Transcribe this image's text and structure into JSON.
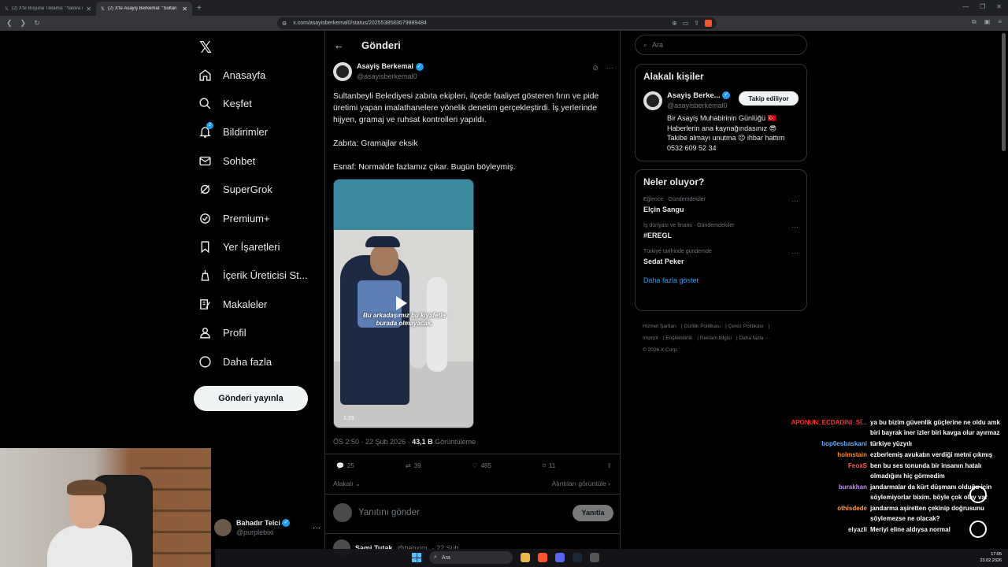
{
  "browser": {
    "tabs": [
      {
        "title": "(2) X'te Boşuna Tıklama: \"Yalova da h",
        "active": false
      },
      {
        "title": "(2) X'te Asayiş Berkemal: \"Sultan",
        "active": true
      }
    ],
    "url": "x.com/asayisberkemal0/status/2025538583679889484"
  },
  "nav": {
    "items": [
      {
        "label": "Anasayfa",
        "icon": "home-icon"
      },
      {
        "label": "Keşfet",
        "icon": "search-icon"
      },
      {
        "label": "Bildirimler",
        "icon": "bell-icon",
        "badge": "2"
      },
      {
        "label": "Sohbet",
        "icon": "mail-icon"
      },
      {
        "label": "SuperGrok",
        "icon": "grok-icon"
      },
      {
        "label": "Premium+",
        "icon": "premium-icon"
      },
      {
        "label": "Yer İşaretleri",
        "icon": "bookmark-icon"
      },
      {
        "label": "İçerik Üreticisi St...",
        "icon": "creator-studio-icon"
      },
      {
        "label": "Makaleler",
        "icon": "articles-icon"
      },
      {
        "label": "Profil",
        "icon": "profile-icon"
      },
      {
        "label": "Daha fazla",
        "icon": "more-icon"
      }
    ],
    "post_button": "Gönderi yayınla"
  },
  "account": {
    "name": "Bahadır Telci",
    "handle": "@purplebixi"
  },
  "main": {
    "title": "Gönderi",
    "post": {
      "author": "Asayiş Berkemal",
      "handle": "@asayisberkemal0",
      "paragraphs": [
        "Sultanbeyli Belediyesi zabıta ekipleri, ilçede faaliyet gösteren fırın ve pide üretimi yapan imalathanelere yönelik denetim gerçekleştirdi. İş yerlerinde hijyen, gramaj ve ruhsat kontrolleri yapıldı.",
        "Zabıta: Gramajlar eksik",
        "Esnaf: Normalde fazlamız çıkar. Bugün böyleymiş."
      ],
      "video": {
        "caption_line1": "Bu arkadaşımız bu kıyafetle",
        "caption_line2": "burada olmayacak.",
        "duration": "1:29"
      },
      "time": "ÖS 2:50",
      "date": "22 Şub 2026",
      "views": "43,1 B",
      "views_label": "Görüntüleme",
      "stats": {
        "replies": "25",
        "reposts": "39",
        "likes": "485",
        "bookmarks": "11"
      },
      "relevancy": "Alakalı",
      "quotes_link": "Alıntıları görüntüle"
    },
    "reply": {
      "placeholder": "Yanıtını gönder",
      "button": "Yanıtla"
    },
    "next_post": {
      "author": "Sami Tutak",
      "handle": "@benxim",
      "time": "· 22 Şub"
    }
  },
  "sidebar": {
    "search_placeholder": "Ara",
    "relevant": {
      "title": "Alakalı kişiler",
      "name": "Asayiş Berke...",
      "handle": "@asayisberkemal0",
      "follow": "Takip ediliyor",
      "bio1": "Bir Asayiş Muhabirinin Günlüğü 🇹🇷",
      "bio2": "Haberlerin ana kaynağındasınız 😎",
      "bio3": "Takibe almayı unutma 😉 ihbar hattım",
      "bio4": "0532 609 52 34"
    },
    "trends": {
      "title": "Neler oluyor?",
      "items": [
        {
          "context": "Eğlence · Gündemdekiler",
          "name": "Elçin Sangu"
        },
        {
          "context": "İş dünyası ve finans · Gündemdekiler",
          "name": "#EREGL"
        },
        {
          "context": "Türkiye tarihinde gündemde",
          "name": "Sedat Peker"
        }
      ],
      "show_more": "Daha fazla göster"
    },
    "footer": [
      "Hizmet Şartları",
      "Gizlilik Politikası",
      "Çerez Politikası",
      "Imprint",
      "Erişilebilirlik",
      "Reklam bilgisi",
      "Daha fazla ···",
      "© 2026 X Corp."
    ]
  },
  "chat": [
    {
      "user": "APONUN_ECDADINI_Sİ...",
      "color": "#ff2a2a",
      "text": "ya bu bizim güvenlik güçlerine ne oldu amk biri bayrak iner izler biri kavga olur ayırmaz"
    },
    {
      "user": "bop0esbaskani",
      "color": "#6aa6ff",
      "text": "türkiye yüzyılı"
    },
    {
      "user": "holmstain",
      "color": "#ff8c1a",
      "text": "ezberlemiş avukatın verdiği metni çıkmış"
    },
    {
      "user": "FeoxS",
      "color": "#ff5a5a",
      "text": "ben bu ses tonunda bir insanın hatalı olmadığını hiç görmedim"
    },
    {
      "user": "burakhan",
      "color": "#c48cff",
      "text": "jandarmalar da kürt düşmanı olduğu için söylemiyorlar bixim. böyle çok olay var"
    },
    {
      "user": "othisdede",
      "color": "#ff9e2c",
      "text": "jandarma aşiretten çekinip doğrusunu söylemezse ne olacak?"
    },
    {
      "user": "elyazli",
      "color": "#e7e9ea",
      "text": "Meriyi eline aldıysa normal"
    }
  ],
  "taskbar": {
    "search": "Ara",
    "time": "17:05",
    "date": "23.02.2026"
  },
  "colors": {
    "accent": "#1d9bf0",
    "background": "#000000",
    "border": "#2f3336",
    "muted": "#71767b"
  }
}
